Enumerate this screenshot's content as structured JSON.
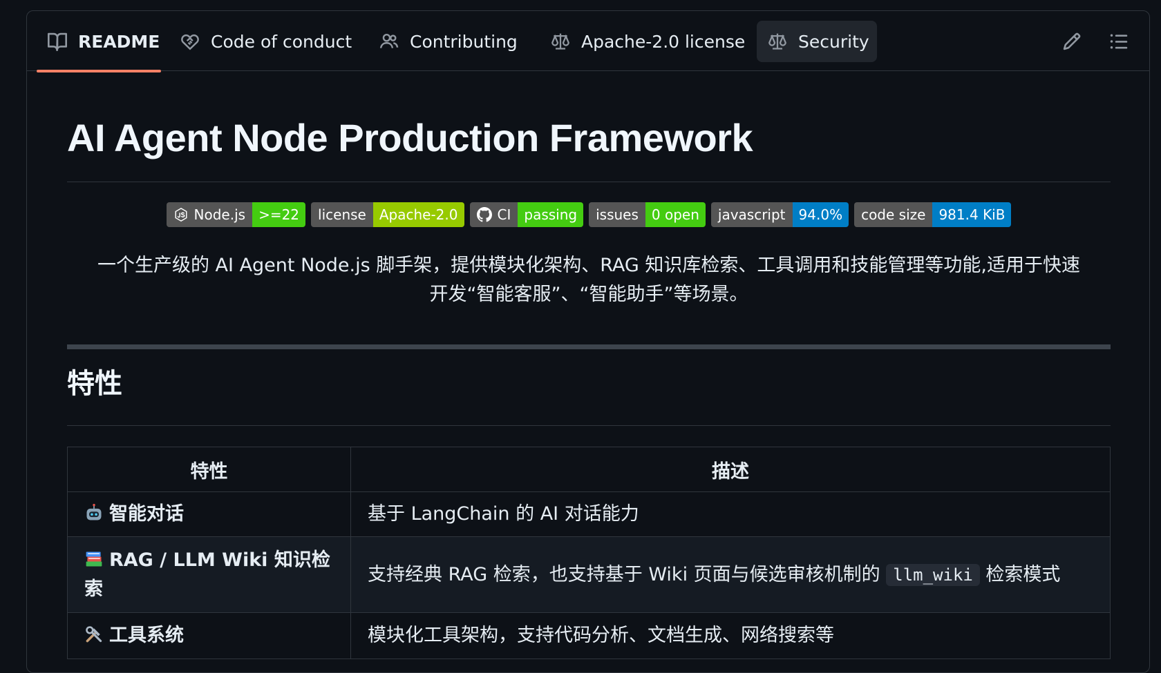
{
  "tabs": [
    {
      "label": "README",
      "icon": "book-icon"
    },
    {
      "label": "Code of conduct",
      "icon": "heart-handshake-icon"
    },
    {
      "label": "Contributing",
      "icon": "people-icon"
    },
    {
      "label": "Apache-2.0 license",
      "icon": "law-scale-icon"
    },
    {
      "label": "Security",
      "icon": "law-scale-icon"
    }
  ],
  "toolbar": {
    "edit_icon": "pencil-icon",
    "toc_icon": "list-unordered-icon"
  },
  "readme": {
    "title": "AI Agent Node Production Framework",
    "badges": [
      {
        "label": "Node.js",
        "value": ">=22",
        "color": "#4c1",
        "icon": "nodejs-icon"
      },
      {
        "label": "license",
        "value": "Apache-2.0",
        "color": "#97ca00"
      },
      {
        "label": "CI",
        "value": "passing",
        "color": "#4c1",
        "icon": "github-icon"
      },
      {
        "label": "issues",
        "value": "0 open",
        "color": "#4c1"
      },
      {
        "label": "javascript",
        "value": "94.0%",
        "color": "#007ec6"
      },
      {
        "label": "code size",
        "value": "981.4 KiB",
        "color": "#007ec6"
      }
    ],
    "intro_line1": "一个生产级的 AI Agent Node.js 脚手架，提供模块化架构、RAG 知识库检索、工具调用和技能管理等功能,适用于快速",
    "intro_line2": "开发“智能客服”、“智能助手”等场景。",
    "features_heading": "特性",
    "table": {
      "headers": [
        "特性",
        "描述"
      ],
      "rows": [
        {
          "emoji": "robot-icon",
          "name": "智能对话",
          "desc": "基于 LangChain 的 AI 对话能力"
        },
        {
          "emoji": "books-icon",
          "name": "RAG / LLM Wiki 知识检索",
          "desc_pre": "支持经典 RAG 检索，也支持基于 Wiki 页面与候选审核机制的 ",
          "desc_code": "llm_wiki",
          "desc_post": " 检索模式"
        },
        {
          "emoji": "tools-icon",
          "name": "工具系统",
          "desc": "模块化工具架构，支持代码分析、文档生成、网络搜索等"
        }
      ]
    }
  }
}
